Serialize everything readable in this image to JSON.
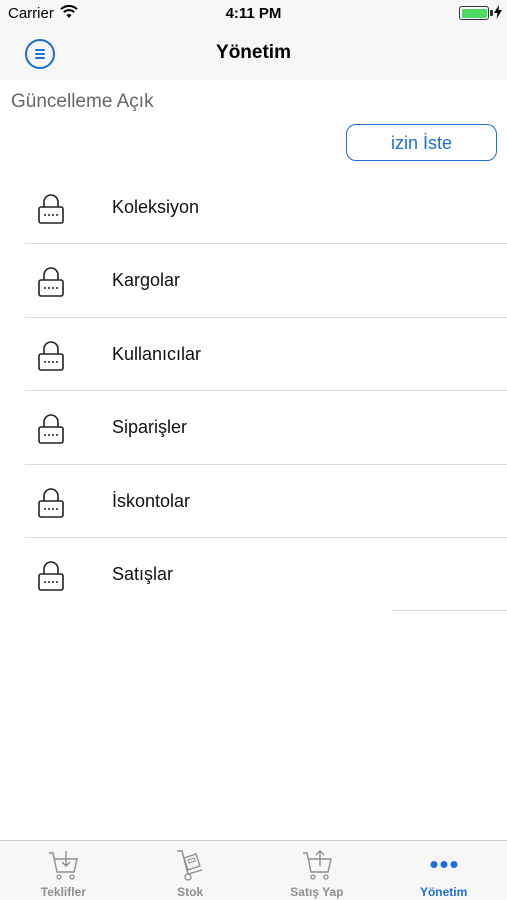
{
  "status_bar": {
    "carrier": "Carrier",
    "time": "4:11 PM",
    "battery_level": 1.0
  },
  "nav": {
    "title": "Yönetim",
    "menu_icon": "hamburger-circle-icon"
  },
  "main": {
    "update_status": "Güncelleme Açık",
    "request_button": "izin İste",
    "items": [
      {
        "label": "Koleksiyon",
        "icon": "lock-icon"
      },
      {
        "label": "Kargolar",
        "icon": "lock-icon"
      },
      {
        "label": "Kullanıcılar",
        "icon": "lock-icon"
      },
      {
        "label": "Siparişler",
        "icon": "lock-icon"
      },
      {
        "label": "İskontolar",
        "icon": "lock-icon"
      },
      {
        "label": "Satışlar",
        "icon": "lock-icon"
      }
    ]
  },
  "tab_bar": {
    "tabs": [
      {
        "label": "Teklifler",
        "icon": "cart-download-icon"
      },
      {
        "label": "Stok",
        "icon": "hand-truck-icon"
      },
      {
        "label": "Satış Yap",
        "icon": "cart-upload-icon"
      },
      {
        "label": "Yönetim",
        "icon": "more-dots-icon",
        "active": true
      }
    ]
  },
  "colors": {
    "accent": "#1a6fd6",
    "battery": "#4cd964",
    "inactive_tab": "#8e8e93"
  }
}
